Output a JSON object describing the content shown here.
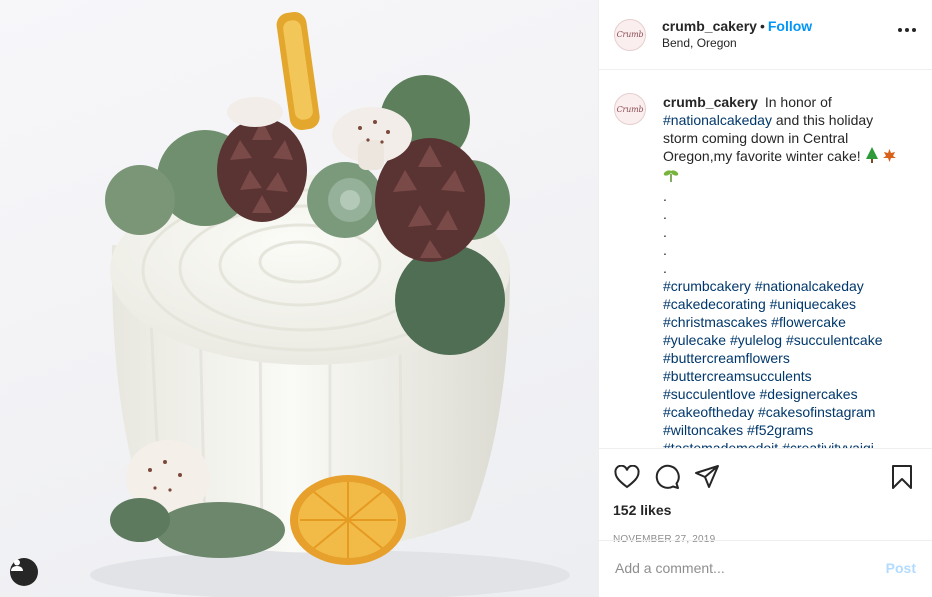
{
  "post": {
    "username": "crumb_cakery",
    "separator": "•",
    "follow_label": "Follow",
    "location": "Bend, Oregon",
    "avatar_text": "Crumb"
  },
  "caption": {
    "username": "crumb_cakery",
    "intro": "In honor of",
    "tag_national": "#nationalcakeday",
    "body": "and this holiday storm coming down in Central Oregon,my favorite winter cake!",
    "dots": [
      ".",
      ".",
      ".",
      ".",
      "."
    ],
    "hashtags": [
      "#crumbcakery",
      "#nationalcakeday",
      "#cakedecorating",
      "#uniquecakes",
      "#christmascakes",
      "#flowercake",
      "#yulecake",
      "#yulelog",
      "#succulentcake",
      "#buttercreamflowers",
      "#buttercreamsucculents",
      "#succulentlove",
      "#designercakes",
      "#cakeoftheday",
      "#cakesofinstagram",
      "#wiltoncakes",
      "#f52grams",
      "#tastemademedoit",
      "#creativityyaigi"
    ]
  },
  "engagement": {
    "likes": "152 likes",
    "date": "NOVEMBER 27, 2019"
  },
  "comment_box": {
    "placeholder": "Add a comment...",
    "post_label": "Post"
  },
  "icons": {
    "like": "heart-icon",
    "comment": "comment-bubble-icon",
    "share": "paper-plane-icon",
    "save": "bookmark-icon",
    "more": "more-options-icon",
    "user_tag": "user-tag-icon"
  },
  "colors": {
    "link_blue": "#0095f6",
    "hashtag": "#00376b",
    "muted": "#8e8e8e",
    "post_disabled": "#b3dbff"
  }
}
